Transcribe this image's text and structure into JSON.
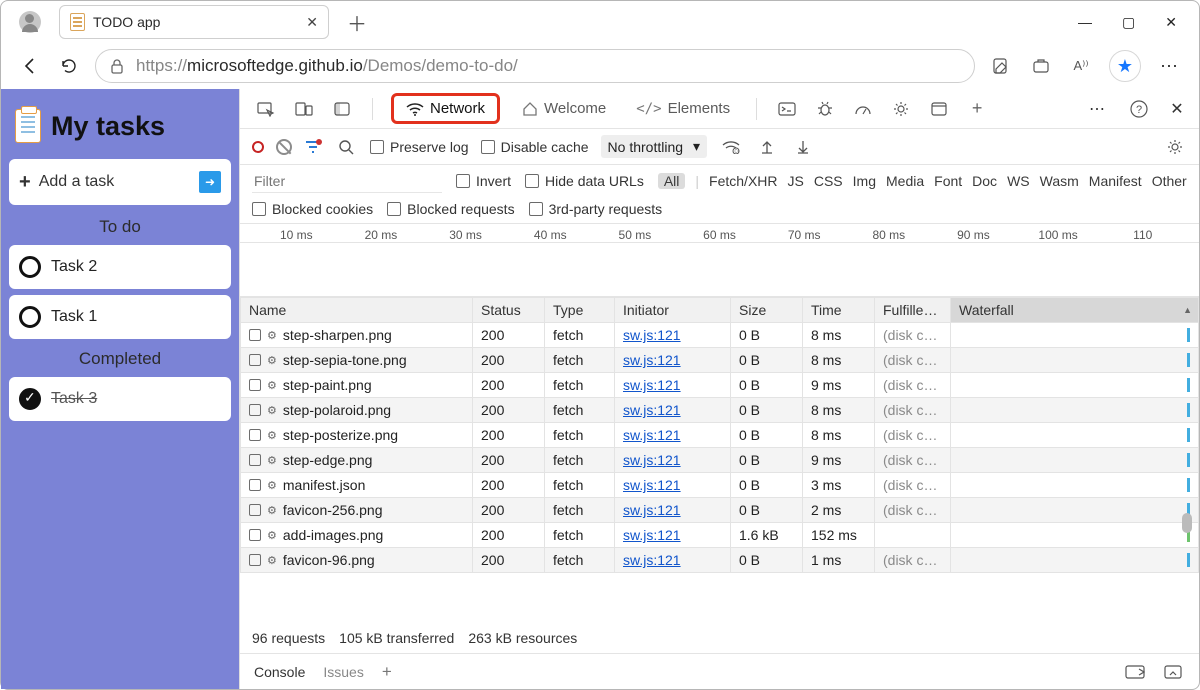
{
  "title_tab": "TODO app",
  "url": {
    "prefix": "https://",
    "host": "microsoftedge.github.io",
    "path": "/Demos/demo-to-do/"
  },
  "app": {
    "title": "My tasks",
    "add_placeholder": "Add a task",
    "sections": {
      "todo": "To do",
      "completed": "Completed"
    },
    "todo": [
      "Task 2",
      "Task 1"
    ],
    "completed": [
      "Task 3"
    ]
  },
  "devtools": {
    "tabs": {
      "network": "Network",
      "welcome": "Welcome",
      "elements": "Elements"
    },
    "toolbar": {
      "preserve": "Preserve log",
      "disable_cache": "Disable cache",
      "throttling": "No throttling"
    },
    "filters": {
      "placeholder": "Filter",
      "invert": "Invert",
      "hide_data": "Hide data URLs",
      "types": [
        "All",
        "Fetch/XHR",
        "JS",
        "CSS",
        "Img",
        "Media",
        "Font",
        "Doc",
        "WS",
        "Wasm",
        "Manifest",
        "Other"
      ],
      "blocked_cookies": "Blocked cookies",
      "blocked_requests": "Blocked requests",
      "third_party": "3rd-party requests"
    },
    "timeline_ticks": [
      "10 ms",
      "20 ms",
      "30 ms",
      "40 ms",
      "50 ms",
      "60 ms",
      "70 ms",
      "80 ms",
      "90 ms",
      "100 ms",
      "110"
    ],
    "columns": [
      "Name",
      "Status",
      "Type",
      "Initiator",
      "Size",
      "Time",
      "Fulfilled…",
      "Waterfall"
    ],
    "rows": [
      {
        "name": "step-sharpen.png",
        "status": "200",
        "type": "fetch",
        "initiator": "sw.js:121",
        "size": "0 B",
        "time": "8 ms",
        "fulfilled": "(disk ca…"
      },
      {
        "name": "step-sepia-tone.png",
        "status": "200",
        "type": "fetch",
        "initiator": "sw.js:121",
        "size": "0 B",
        "time": "8 ms",
        "fulfilled": "(disk ca…"
      },
      {
        "name": "step-paint.png",
        "status": "200",
        "type": "fetch",
        "initiator": "sw.js:121",
        "size": "0 B",
        "time": "9 ms",
        "fulfilled": "(disk ca…"
      },
      {
        "name": "step-polaroid.png",
        "status": "200",
        "type": "fetch",
        "initiator": "sw.js:121",
        "size": "0 B",
        "time": "8 ms",
        "fulfilled": "(disk ca…"
      },
      {
        "name": "step-posterize.png",
        "status": "200",
        "type": "fetch",
        "initiator": "sw.js:121",
        "size": "0 B",
        "time": "8 ms",
        "fulfilled": "(disk ca…"
      },
      {
        "name": "step-edge.png",
        "status": "200",
        "type": "fetch",
        "initiator": "sw.js:121",
        "size": "0 B",
        "time": "9 ms",
        "fulfilled": "(disk ca…"
      },
      {
        "name": "manifest.json",
        "status": "200",
        "type": "fetch",
        "initiator": "sw.js:121",
        "size": "0 B",
        "time": "3 ms",
        "fulfilled": "(disk ca…"
      },
      {
        "name": "favicon-256.png",
        "status": "200",
        "type": "fetch",
        "initiator": "sw.js:121",
        "size": "0 B",
        "time": "2 ms",
        "fulfilled": "(disk ca…"
      },
      {
        "name": "add-images.png",
        "status": "200",
        "type": "fetch",
        "initiator": "sw.js:121",
        "size": "1.6 kB",
        "time": "152 ms",
        "fulfilled": ""
      },
      {
        "name": "favicon-96.png",
        "status": "200",
        "type": "fetch",
        "initiator": "sw.js:121",
        "size": "0 B",
        "time": "1 ms",
        "fulfilled": "(disk ca…"
      }
    ],
    "status_summary": {
      "requests": "96 requests",
      "transferred": "105 kB transferred",
      "resources": "263 kB resources"
    },
    "drawer": {
      "console": "Console",
      "issues": "Issues"
    }
  }
}
